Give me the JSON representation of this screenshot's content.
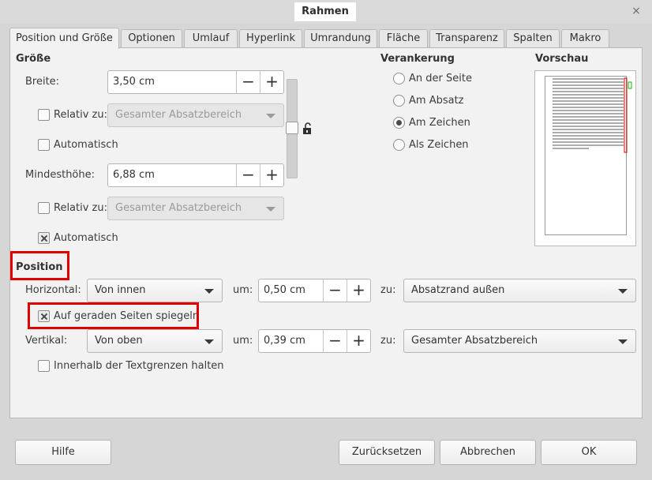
{
  "window": {
    "title": "Rahmen",
    "close_symbol": "×"
  },
  "tabs": [
    {
      "label": "Position und Größe",
      "active": true
    },
    {
      "label": "Optionen"
    },
    {
      "label": "Umlauf"
    },
    {
      "label": "Hyperlink"
    },
    {
      "label": "Umrandung"
    },
    {
      "label": "Fläche"
    },
    {
      "label": "Transparenz"
    },
    {
      "label": "Spalten"
    },
    {
      "label": "Makro"
    }
  ],
  "size": {
    "title": "Größe",
    "width_label": "Breite:",
    "width_value": "3,50 cm",
    "width_relative_label": "Relativ zu:",
    "width_relative_value": "Gesamter Absatzbereich",
    "width_automatic_label": "Automatisch",
    "minheight_label": "Mindesthöhe:",
    "minheight_value": "6,88 cm",
    "height_relative_label": "Relativ zu:",
    "height_relative_value": "Gesamter Absatzbereich",
    "height_automatic_label": "Automatisch",
    "minus": "−",
    "plus": "+"
  },
  "anchor": {
    "title": "Verankerung",
    "options": [
      "An der Seite",
      "Am Absatz",
      "Am Zeichen",
      "Als Zeichen"
    ],
    "selected": "Am Zeichen"
  },
  "preview": {
    "title": "Vorschau"
  },
  "position": {
    "title": "Position",
    "horizontal_label": "Horizontal:",
    "horizontal_value": "Von innen",
    "horizontal_by_label": "um:",
    "horizontal_by_value": "0,50 cm",
    "horizontal_to_label": "zu:",
    "horizontal_to_value": "Absatzrand außen",
    "mirror_label": "Auf geraden Seiten spiegeln",
    "vertical_label": "Vertikal:",
    "vertical_value": "Von oben",
    "vertical_by_label": "um:",
    "vertical_by_value": "0,39 cm",
    "vertical_to_label": "zu:",
    "vertical_to_value": "Gesamter Absatzbereich",
    "keep_inside_label": "Innerhalb der Textgrenzen halten"
  },
  "buttons": {
    "help": "Hilfe",
    "reset": "Zurücksetzen",
    "cancel": "Abbrechen",
    "ok": "OK"
  },
  "colors": {
    "highlight": "#e00000",
    "preview_frame": "#d40000",
    "preview_anchor": "#00c000"
  }
}
